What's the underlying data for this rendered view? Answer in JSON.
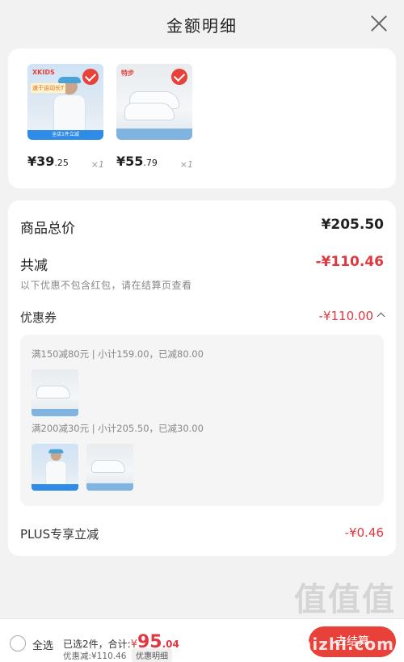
{
  "header": {
    "title": "金额明细"
  },
  "products": [
    {
      "name": "kids-tshirt",
      "price_int": "¥39",
      "price_dec": ".25",
      "qty": "×1",
      "brand": "XKIDS",
      "tag": "速干运动长T",
      "banner": "全店1件立减"
    },
    {
      "name": "white-sneaker",
      "price_int": "¥55",
      "price_dec": ".79",
      "qty": "×1",
      "brand": "特步"
    }
  ],
  "summary": {
    "total_label": "商品总价",
    "total_value": "¥205.50",
    "discount_label": "共减",
    "discount_value": "-¥110.46",
    "discount_note": "以下优惠不包含红包，请在结算页查看",
    "coupon_label": "优惠券",
    "coupon_value": "-¥110.00",
    "coupon_rule_1": "满150减80元 | 小计159.00，已减80.00",
    "coupon_rule_2": "满200减30元 | 小计205.50，已减30.00",
    "plus_label": "PLUS专享立减",
    "plus_value": "-¥0.46"
  },
  "bottom_bar": {
    "select_all": "全选",
    "selected_text": "已选2件，合计:",
    "currency": "¥",
    "total_int": "95",
    "total_dec": ".04",
    "discount_text": "优惠减:¥110.46",
    "detail_label": "优惠明细",
    "checkout_label": "去结算"
  },
  "watermark": {
    "text": "值值值",
    "url": "zhizhizhi.com"
  },
  "colors": {
    "accent": "#e8413a",
    "discount_red": "#e0383e",
    "background": "#f2f2f2"
  }
}
